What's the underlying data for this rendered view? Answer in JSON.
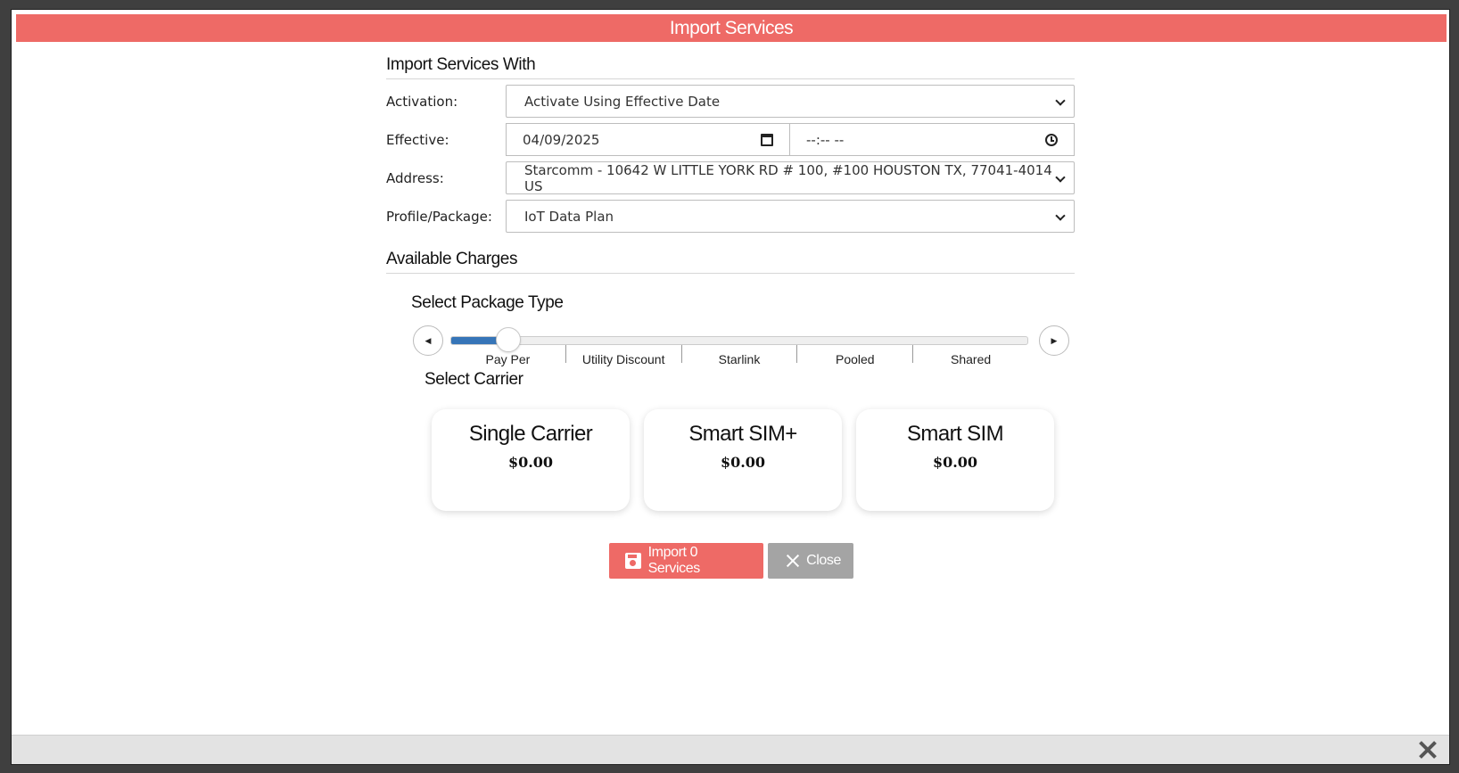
{
  "dialog": {
    "title": "Import Services"
  },
  "import_with": {
    "heading": "Import Services With",
    "activation": {
      "label": "Activation:",
      "value": "Activate Using Effective Date"
    },
    "effective": {
      "label": "Effective:",
      "date": "04/09/2025",
      "time": "--:-- --"
    },
    "address": {
      "label": "Address:",
      "value": "Starcomm - 10642 W LITTLE YORK RD # 100, #100 HOUSTON TX, 77041-4014 US"
    },
    "profile": {
      "label": "Profile/Package:",
      "value": "IoT Data Plan"
    }
  },
  "charges": {
    "heading": "Available Charges",
    "package_type": {
      "heading": "Select Package Type",
      "options": [
        "Pay Per",
        "Utility Discount",
        "Starlink",
        "Pooled",
        "Shared"
      ],
      "selected_index": 0,
      "slider_value": 0.1
    },
    "carrier": {
      "heading": "Select Carrier",
      "cards": [
        {
          "name": "Single Carrier",
          "price": "$0.00"
        },
        {
          "name": "Smart SIM+",
          "price": "$0.00"
        },
        {
          "name": "Smart SIM",
          "price": "$0.00"
        }
      ]
    }
  },
  "actions": {
    "import_label": "Import 0 Services",
    "close_label": "Close"
  },
  "colors": {
    "accent": "#ee6a66",
    "slider_fill": "#3675b8",
    "close_button": "#a4a4a4"
  }
}
